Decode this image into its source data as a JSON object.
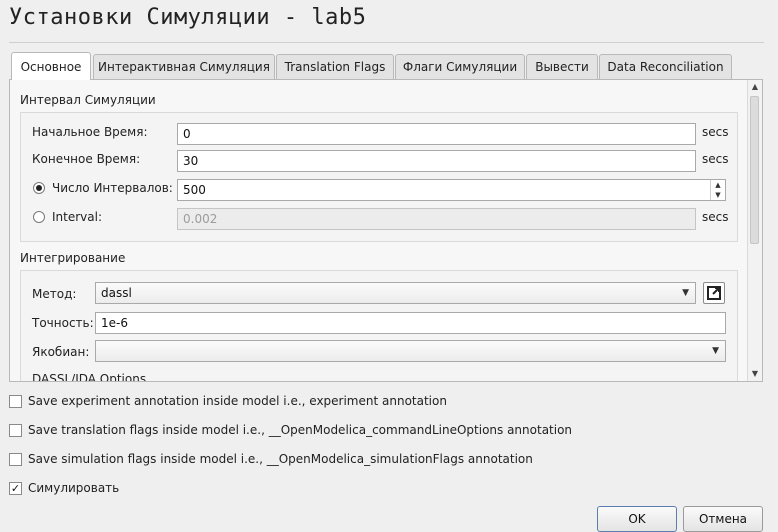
{
  "window": {
    "title": "Установки Симуляции - lab5"
  },
  "tabs": [
    {
      "label": "Основное",
      "active": true
    },
    {
      "label": "Интерактивная Симуляция",
      "active": false
    },
    {
      "label": "Translation Flags",
      "active": false
    },
    {
      "label": "Флаги Симуляции",
      "active": false
    },
    {
      "label": "Вывести",
      "active": false
    },
    {
      "label": "Data Reconciliation",
      "active": false
    }
  ],
  "interval": {
    "title": "Интервал Симуляции",
    "start_label": "Начальное Время:",
    "start_value": "0",
    "stop_label": "Конечное Время:",
    "stop_value": "30",
    "unit": "secs",
    "num_intervals_label": "Число Интервалов:",
    "num_intervals_value": "500",
    "num_intervals_selected": true,
    "interval_label": "Interval:",
    "interval_value": "0.002",
    "interval_selected": false
  },
  "integration": {
    "title": "Интегрирование",
    "method_label": "Метод:",
    "method_value": "dassl",
    "tolerance_label": "Точность:",
    "tolerance_value": "1e-6",
    "jacobian_label": "Якобиан:",
    "jacobian_value": "",
    "dassl_options_label": "DASSL/IDA Options"
  },
  "checkboxes": [
    {
      "label": "Save experiment annotation inside model i.e., experiment annotation",
      "checked": false
    },
    {
      "label": "Save translation flags inside model i.e., __OpenModelica_commandLineOptions annotation",
      "checked": false
    },
    {
      "label": "Save simulation flags inside model i.e., __OpenModelica_simulationFlags annotation",
      "checked": false
    },
    {
      "label": "Симулировать",
      "checked": true
    }
  ],
  "buttons": {
    "ok": "OK",
    "cancel": "Отмена"
  },
  "icons": {
    "check_mark": "✓",
    "combo_arrow": "▼",
    "spin_up": "▲",
    "spin_down": "▼",
    "scroll_up": "▲",
    "scroll_down": "▼"
  }
}
